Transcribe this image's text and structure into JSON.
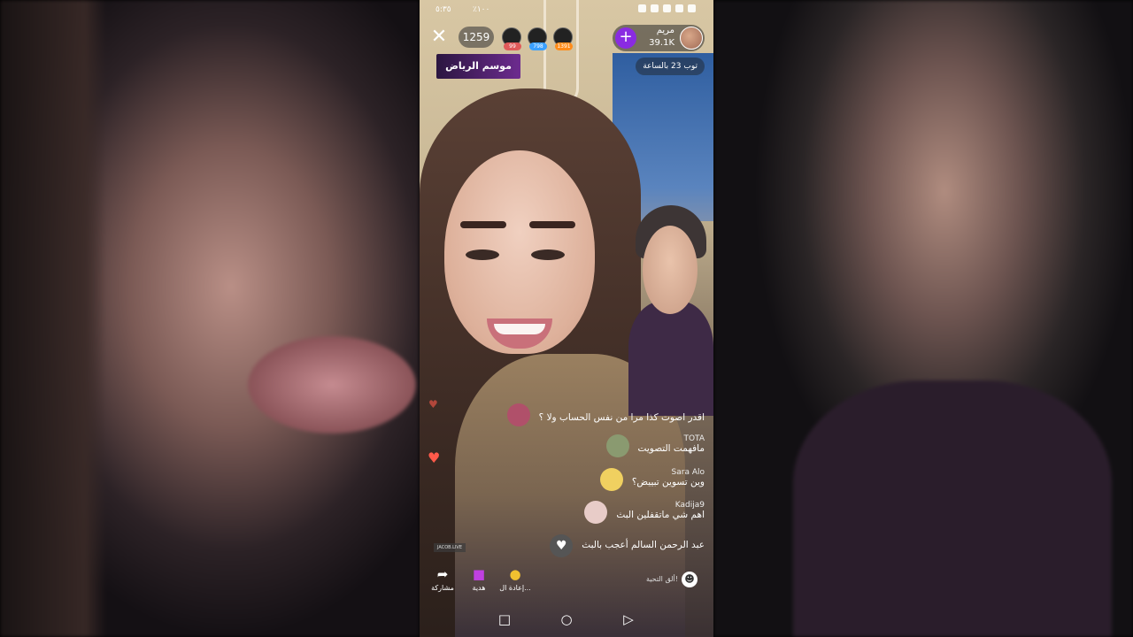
{
  "status_bar": {
    "time": "٥:٣٥",
    "battery": "٪١٠٠"
  },
  "header": {
    "viewer_count": "1259",
    "top_viewers": [
      {
        "badge": "99",
        "badge_color": "#e05a5a"
      },
      {
        "badge": "798",
        "badge_color": "#3aa0ff"
      },
      {
        "badge": "1391",
        "badge_color": "#ff8c1a"
      }
    ],
    "banner_text": "موسم الرياض",
    "host": {
      "name": "مريم",
      "likes": "39.1K"
    },
    "rank_text": "توب 23 بالساعة"
  },
  "comments": [
    {
      "user": "",
      "text": "اقدر اصوت كذا مرا من نفس الحساب ولا ؟",
      "avatar_color": "#b0506a"
    },
    {
      "user": "TOTA",
      "text": "مافهمت التصويت",
      "avatar_color": "#8a9a70"
    },
    {
      "user": "Sara Alo",
      "text": "وين تسوين تبييض؟",
      "avatar_color": "#f0d060"
    },
    {
      "user": "Kadija9",
      "text": "اهم شي ماتقفلين البث",
      "avatar_color": "#e8ccc8"
    },
    {
      "user": "",
      "text": "عبد الرحمن السالم أعجب بالبث",
      "avatar_color": "#555555"
    }
  ],
  "watermark": "JACOB.LIVE",
  "actions": {
    "share": "مشاركة",
    "gift": "هدية",
    "replay": "إعادة ال..."
  },
  "compose_placeholder": "ألق التحية!",
  "accent_color": "#8a2be2"
}
